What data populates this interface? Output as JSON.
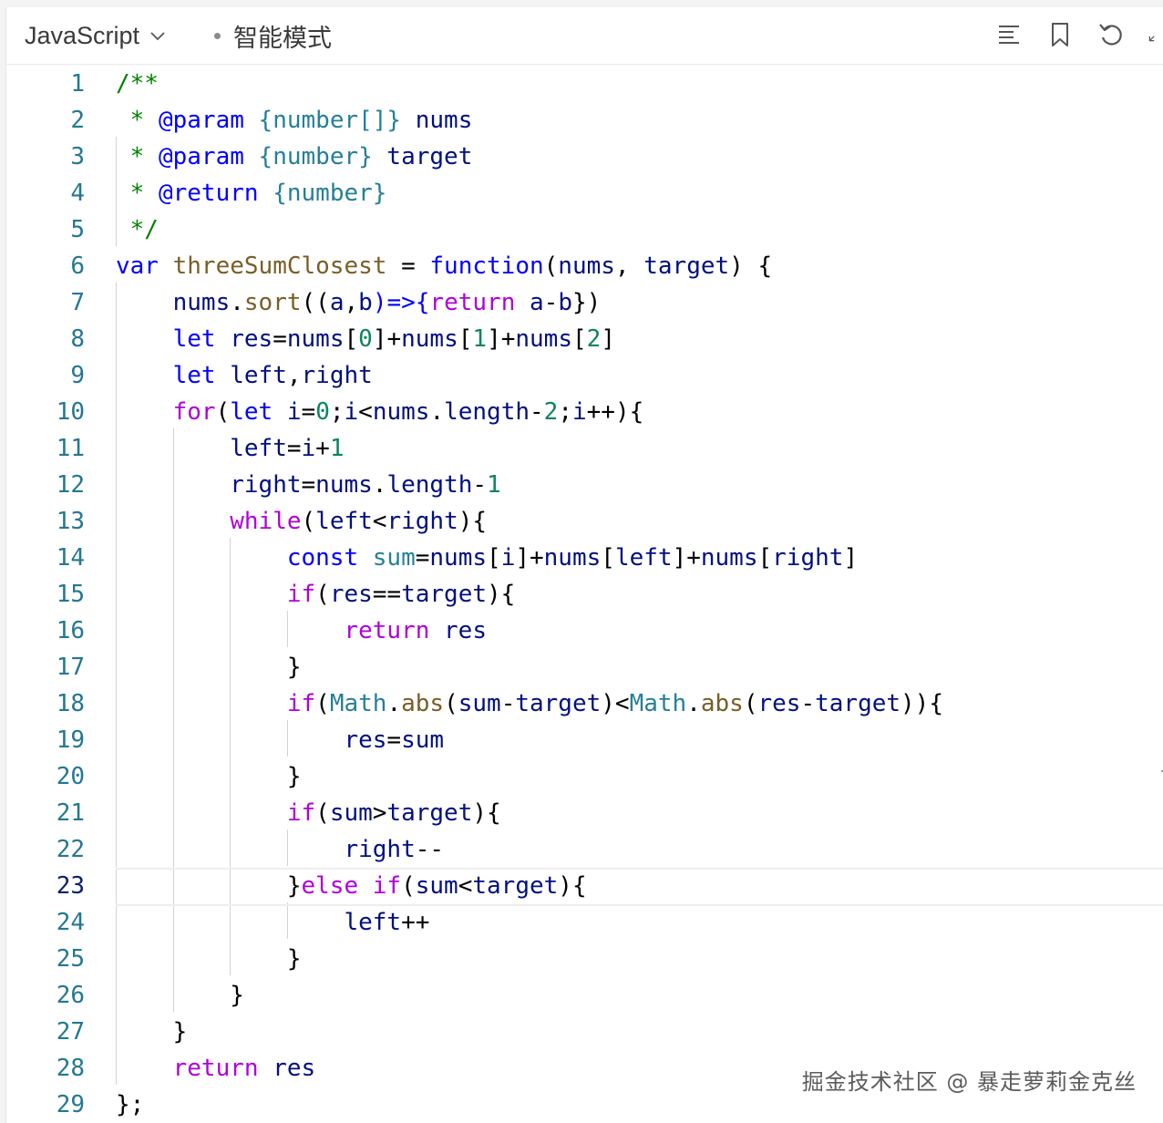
{
  "toolbar": {
    "language": "JavaScript",
    "mode": "智能模式",
    "icons": [
      "format-icon",
      "bookmark-icon",
      "undo-icon",
      "expand-icon"
    ]
  },
  "editor": {
    "active_line": 23,
    "lines": [
      [
        [
          "/**",
          "cm"
        ]
      ],
      [
        [
          " * ",
          "cm"
        ],
        [
          "@param",
          "cmk"
        ],
        [
          " ",
          "cm"
        ],
        [
          "{number[]}",
          "cmt"
        ],
        [
          " nums",
          "vr"
        ]
      ],
      [
        [
          " * ",
          "cm"
        ],
        [
          "@param",
          "cmk"
        ],
        [
          " ",
          "cm"
        ],
        [
          "{number}",
          "cmt"
        ],
        [
          " target",
          "vr"
        ]
      ],
      [
        [
          " * ",
          "cm"
        ],
        [
          "@return",
          "cmk"
        ],
        [
          " ",
          "cm"
        ],
        [
          "{number}",
          "cmt"
        ]
      ],
      [
        [
          " */",
          "cm"
        ]
      ],
      [
        [
          "var",
          "kw"
        ],
        [
          " ",
          "pn"
        ],
        [
          "threeSumClosest",
          "fn"
        ],
        [
          " = ",
          "op"
        ],
        [
          "function",
          "kw"
        ],
        [
          "(",
          "pn"
        ],
        [
          "nums",
          "vr"
        ],
        [
          ", ",
          "pn"
        ],
        [
          "target",
          "vr"
        ],
        [
          ") {",
          "pn"
        ]
      ],
      [
        [
          "    ",
          "pn"
        ],
        [
          "nums",
          "vr"
        ],
        [
          ".",
          "pn"
        ],
        [
          "sort",
          "fn"
        ],
        [
          "((",
          "pn"
        ],
        [
          "a",
          "vr"
        ],
        [
          ",",
          "pn"
        ],
        [
          "b",
          "vr"
        ],
        [
          ")=>{",
          "kw"
        ],
        [
          "return",
          "kf"
        ],
        [
          " ",
          "pn"
        ],
        [
          "a",
          "vr"
        ],
        [
          "-",
          "op"
        ],
        [
          "b",
          "vr"
        ],
        [
          "})",
          "pn"
        ]
      ],
      [
        [
          "    ",
          "pn"
        ],
        [
          "let",
          "kw"
        ],
        [
          " ",
          "pn"
        ],
        [
          "res",
          "vr"
        ],
        [
          "=",
          "op"
        ],
        [
          "nums",
          "vr"
        ],
        [
          "[",
          "pn"
        ],
        [
          "0",
          "nm"
        ],
        [
          "]+",
          "pn"
        ],
        [
          "nums",
          "vr"
        ],
        [
          "[",
          "pn"
        ],
        [
          "1",
          "nm"
        ],
        [
          "]+",
          "pn"
        ],
        [
          "nums",
          "vr"
        ],
        [
          "[",
          "pn"
        ],
        [
          "2",
          "nm"
        ],
        [
          "]",
          "pn"
        ]
      ],
      [
        [
          "    ",
          "pn"
        ],
        [
          "let",
          "kw"
        ],
        [
          " ",
          "pn"
        ],
        [
          "left",
          "vr"
        ],
        [
          ",",
          "pn"
        ],
        [
          "right",
          "vr"
        ]
      ],
      [
        [
          "    ",
          "pn"
        ],
        [
          "for",
          "kf"
        ],
        [
          "(",
          "pn"
        ],
        [
          "let",
          "kw"
        ],
        [
          " ",
          "pn"
        ],
        [
          "i",
          "vr"
        ],
        [
          "=",
          "op"
        ],
        [
          "0",
          "nm"
        ],
        [
          ";",
          "pn"
        ],
        [
          "i",
          "vr"
        ],
        [
          "<",
          "op"
        ],
        [
          "nums",
          "vr"
        ],
        [
          ".",
          "pn"
        ],
        [
          "length",
          "vr"
        ],
        [
          "-",
          "op"
        ],
        [
          "2",
          "nm"
        ],
        [
          ";",
          "pn"
        ],
        [
          "i",
          "vr"
        ],
        [
          "++){",
          "pn"
        ]
      ],
      [
        [
          "        ",
          "pn"
        ],
        [
          "left",
          "vr"
        ],
        [
          "=",
          "op"
        ],
        [
          "i",
          "vr"
        ],
        [
          "+",
          "op"
        ],
        [
          "1",
          "nm"
        ]
      ],
      [
        [
          "        ",
          "pn"
        ],
        [
          "right",
          "vr"
        ],
        [
          "=",
          "op"
        ],
        [
          "nums",
          "vr"
        ],
        [
          ".",
          "pn"
        ],
        [
          "length",
          "vr"
        ],
        [
          "-",
          "op"
        ],
        [
          "1",
          "nm"
        ]
      ],
      [
        [
          "        ",
          "pn"
        ],
        [
          "while",
          "kf"
        ],
        [
          "(",
          "pn"
        ],
        [
          "left",
          "vr"
        ],
        [
          "<",
          "op"
        ],
        [
          "right",
          "vr"
        ],
        [
          "){",
          "pn"
        ]
      ],
      [
        [
          "            ",
          "pn"
        ],
        [
          "const",
          "kw"
        ],
        [
          " ",
          "pn"
        ],
        [
          "sum",
          "cl"
        ],
        [
          "=",
          "op"
        ],
        [
          "nums",
          "vr"
        ],
        [
          "[",
          "pn"
        ],
        [
          "i",
          "vr"
        ],
        [
          "]+",
          "pn"
        ],
        [
          "nums",
          "vr"
        ],
        [
          "[",
          "pn"
        ],
        [
          "left",
          "vr"
        ],
        [
          "]+",
          "pn"
        ],
        [
          "nums",
          "vr"
        ],
        [
          "[",
          "pn"
        ],
        [
          "right",
          "vr"
        ],
        [
          "]",
          "pn"
        ]
      ],
      [
        [
          "            ",
          "pn"
        ],
        [
          "if",
          "kf"
        ],
        [
          "(",
          "pn"
        ],
        [
          "res",
          "vr"
        ],
        [
          "==",
          "op"
        ],
        [
          "target",
          "vr"
        ],
        [
          "){",
          "pn"
        ]
      ],
      [
        [
          "                ",
          "pn"
        ],
        [
          "return",
          "kf"
        ],
        [
          " ",
          "pn"
        ],
        [
          "res",
          "vr"
        ]
      ],
      [
        [
          "            ",
          "pn"
        ],
        [
          "}",
          "pn"
        ]
      ],
      [
        [
          "            ",
          "pn"
        ],
        [
          "if",
          "kf"
        ],
        [
          "(",
          "pn"
        ],
        [
          "Math",
          "cl"
        ],
        [
          ".",
          "pn"
        ],
        [
          "abs",
          "fn"
        ],
        [
          "(",
          "pn"
        ],
        [
          "sum",
          "vr"
        ],
        [
          "-",
          "op"
        ],
        [
          "target",
          "vr"
        ],
        [
          ")<",
          "pn"
        ],
        [
          "Math",
          "cl"
        ],
        [
          ".",
          "pn"
        ],
        [
          "abs",
          "fn"
        ],
        [
          "(",
          "pn"
        ],
        [
          "res",
          "vr"
        ],
        [
          "-",
          "op"
        ],
        [
          "target",
          "vr"
        ],
        [
          ")){",
          "pn"
        ]
      ],
      [
        [
          "                ",
          "pn"
        ],
        [
          "res",
          "vr"
        ],
        [
          "=",
          "op"
        ],
        [
          "sum",
          "vr"
        ]
      ],
      [
        [
          "            ",
          "pn"
        ],
        [
          "}",
          "pn"
        ]
      ],
      [
        [
          "            ",
          "pn"
        ],
        [
          "if",
          "kf"
        ],
        [
          "(",
          "pn"
        ],
        [
          "sum",
          "vr"
        ],
        [
          ">",
          "op"
        ],
        [
          "target",
          "vr"
        ],
        [
          "){",
          "pn"
        ]
      ],
      [
        [
          "                ",
          "pn"
        ],
        [
          "right",
          "vr"
        ],
        [
          "--",
          "op"
        ]
      ],
      [
        [
          "            ",
          "pn"
        ],
        [
          "}",
          "pn"
        ],
        [
          "else",
          "kf"
        ],
        [
          " ",
          "pn"
        ],
        [
          "if",
          "kf"
        ],
        [
          "(",
          "pn"
        ],
        [
          "sum",
          "vr"
        ],
        [
          "<",
          "op"
        ],
        [
          "target",
          "vr"
        ],
        [
          "){",
          "pn"
        ]
      ],
      [
        [
          "                ",
          "pn"
        ],
        [
          "left",
          "vr"
        ],
        [
          "++",
          "op"
        ]
      ],
      [
        [
          "            ",
          "pn"
        ],
        [
          "}",
          "pn"
        ]
      ],
      [
        [
          "        ",
          "pn"
        ],
        [
          "}",
          "pn"
        ]
      ],
      [
        [
          "    ",
          "pn"
        ],
        [
          "}",
          "pn"
        ]
      ],
      [
        [
          "    ",
          "pn"
        ],
        [
          "return",
          "kf"
        ],
        [
          " ",
          "pn"
        ],
        [
          "res",
          "vr"
        ]
      ],
      [
        [
          "};",
          "pn"
        ]
      ]
    ]
  },
  "watermark": "掘金技术社区 @ 暴走萝莉金克丝"
}
